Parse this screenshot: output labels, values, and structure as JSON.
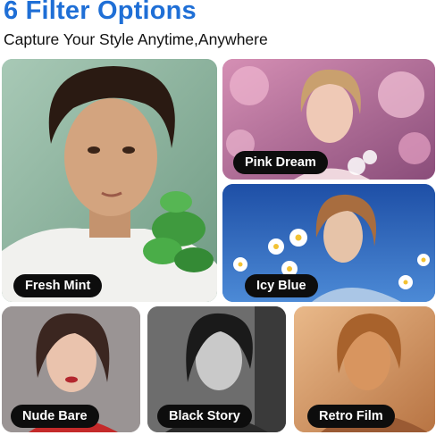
{
  "header": {
    "title": "6 Filter Options",
    "subtitle": "Capture Your Style Anytime,Anywhere"
  },
  "filters": [
    {
      "id": "fresh-mint",
      "label": "Fresh Mint",
      "accent": "#8fb6a3"
    },
    {
      "id": "pink-dream",
      "label": "Pink Dream",
      "accent": "#c07aa2"
    },
    {
      "id": "icy-blue",
      "label": "Icy Blue",
      "accent": "#2c63b5"
    },
    {
      "id": "nude-bare",
      "label": "Nude Bare",
      "accent": "#8c8686"
    },
    {
      "id": "black-story",
      "label": "Black Story",
      "accent": "#7c7c7c"
    },
    {
      "id": "retro-film",
      "label": "Retro Film",
      "accent": "#d7a070"
    }
  ],
  "colors": {
    "title": "#1f6fd6",
    "label_background": "#0d0d0d",
    "label_text": "#ffffff"
  }
}
